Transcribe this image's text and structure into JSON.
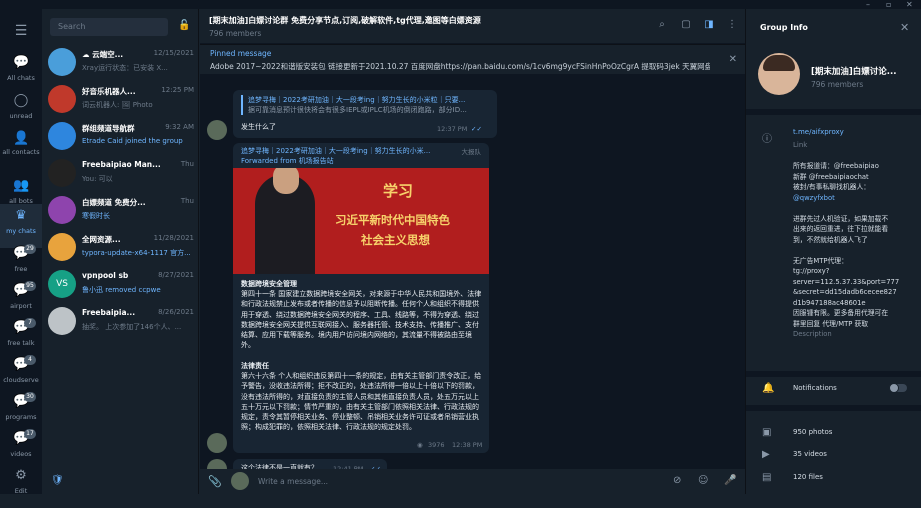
{
  "window_controls": [
    "–",
    "▫",
    "✕"
  ],
  "folders": [
    {
      "label": "All chats",
      "icon": "chat-bubbles-icon",
      "badge": ""
    },
    {
      "label": "unread",
      "icon": "chat-bubble-icon",
      "badge": ""
    },
    {
      "label": "all contacts",
      "icon": "person-icon",
      "badge": ""
    },
    {
      "label": "all bots",
      "icon": "bot-icon",
      "badge": ""
    },
    {
      "label": "my chats",
      "icon": "crown-icon",
      "badge": ""
    },
    {
      "label": "free",
      "icon": "chat-bubble-icon",
      "badge": "29"
    },
    {
      "label": "airport",
      "icon": "chat-bubble-icon",
      "badge": "95"
    },
    {
      "label": "free talk",
      "icon": "chat-bubble-icon",
      "badge": "7"
    },
    {
      "label": "cloudserve",
      "icon": "chat-bubble-icon",
      "badge": "4"
    },
    {
      "label": "programs",
      "icon": "chat-bubble-icon",
      "badge": "30"
    },
    {
      "label": "videos",
      "icon": "chat-bubble-icon",
      "badge": "17"
    },
    {
      "label": "Edit",
      "icon": "sliders-icon",
      "badge": ""
    }
  ],
  "search": {
    "placeholder": "Search"
  },
  "chats": [
    {
      "name": "☁ 云端空...",
      "time": "12/15/2021",
      "preview": "Xray运行状态：已安装 X...",
      "blue": false,
      "avatar": "#4a9eda",
      "initials": ""
    },
    {
      "name": "好音乐机器人...",
      "time": "12:25 PM",
      "preview": "词云机器人: 🖼 Photo",
      "blue": false,
      "avatar": "#c0392b",
      "initials": ""
    },
    {
      "name": "群组频道导航群",
      "time": "9:32 AM",
      "preview": "Etrade Caid joined the group",
      "blue": true,
      "avatar": "#2e86de",
      "initials": ""
    },
    {
      "name": "Freebaipiao Man...",
      "time": "Thu",
      "preview": "You: 可以",
      "blue": false,
      "avatar": "#222",
      "initials": ""
    },
    {
      "name": "白嫖频道 免费分...",
      "time": "Thu",
      "preview": "寒假时长",
      "blue": true,
      "avatar": "#8e44ad",
      "initials": ""
    },
    {
      "name": "全网资源...",
      "time": "11/28/2021",
      "preview": "typora-update-x64-1117 官方...",
      "blue": true,
      "avatar": "#e8a33d",
      "initials": ""
    },
    {
      "name": "vpnpool sb",
      "time": "8/27/2021",
      "preview": "鲁小迅 removed ccpwe",
      "blue": true,
      "avatar": "#16a085",
      "initials": "VS"
    },
    {
      "name": "Freebaipia...",
      "time": "8/26/2021",
      "preview": "抽奖。 上次参加了146个人、...",
      "blue": false,
      "avatar": "#bdc3c7",
      "initials": ""
    }
  ],
  "header": {
    "title": "[期末加油]白嫖讨论群 免费分享节点,订阅,破解软件,tg代理,邀图等白嫖资源",
    "members": "796 members"
  },
  "pinned": {
    "label": "Pinned message",
    "text": "Adobe 2017~2022和谐版安装包 链接更新于2021.10.27 百度网盘https://pan.baidu.com/s/1cv6mg9ycFSinHnPoOzCgrA 提取码3jek 天翼网盘ht..."
  },
  "messages": {
    "m1": {
      "reply_name": "追梦寻梅｜2022考研加油｜大一段考ing｜努力生长的小米粒｜只要...",
      "reply_text": "据可靠消息预计很快将会有很多IEPL或IPLC机场的倒闭跑路，部分ID...",
      "text": "发生什么了",
      "time": "12:37 PM"
    },
    "m2": {
      "sender": "追梦寻梅｜2022考研加油｜大一段考ing｜努力生长的小米...",
      "role": "大报队",
      "forwarded": "Forwarded from 机场报告站",
      "banner_l1": "学习",
      "banner_l2": "习近平新时代中国特色",
      "banner_l3": "社会主义思想",
      "p1_title": "数据跨境安全管理",
      "p1": "第四十一条 国家建立数据跨境安全网关，对来源于中华人民共和国境外、法律和行政法规禁止发布或者传播的信息予以阻断传播。任何个人和组织不得提供用于穿透、绕过数据跨境安全网关的程序、工具、线路等，不得为穿透、绕过数据跨境安全网关提供互联网接入、服务器托管、技术支持、传播推广、支付结算、应用下载等服务。境内用户访问境内网络的，其流量不得被路由至境外。",
      "p2_title": "法律责任",
      "p2": "第六十六条 个人和组织违反第四十一条的规定，由有关主管部门责令改正，给予警告，没收违法所得；拒不改正的，处违法所得一倍以上十倍以下的罚款，没有违法所得的，对直接负责的主管人员和其他直接负责人员，处五万元以上五十万元以下罚款；情节严重的，由有关主管部门依照相关法律、行政法规的规定，责令其暂停相关业务、停业整顿、吊销相关业务许可证或者吊销营业执照；构成犯罪的，依照相关法律、行政法规的规定处罚。",
      "views": "3976",
      "time": "12:38 PM"
    },
    "m3": {
      "text": "这个法律不是一直就有？",
      "time": "12:41 PM"
    }
  },
  "compose": {
    "placeholder": "Write a message..."
  },
  "group_info": {
    "title": "Group Info",
    "name": "[期末加油]白嫖讨论...",
    "members": "796 members",
    "link": "t.me/aifxproxy",
    "link_label": "Link",
    "desc": [
      "所有报道请：@freebaipiao",
      "新群 @freebaipiaochat",
      "被封/有事私聊找机器人：",
      "@qwzyfxbot",
      "",
      "进群先过人机验证，如果加载不",
      "出来的返回重进，往下拉就能看",
      "到，不然就给机器人飞了",
      "",
      "无广告MTP代理：",
      "tg://proxy?",
      "server=112.5.37.33&port=777",
      "&secret=dd15dadb6cecee827",
      "d1b947188ac48601e",
      "因服锺有限。更多备用代理可在",
      "群里回复 代理/MTP 获取"
    ],
    "desc_label": "Description",
    "notifications": "Notifications",
    "photos": "950 photos",
    "videos": "35 videos",
    "files": "120 files"
  }
}
